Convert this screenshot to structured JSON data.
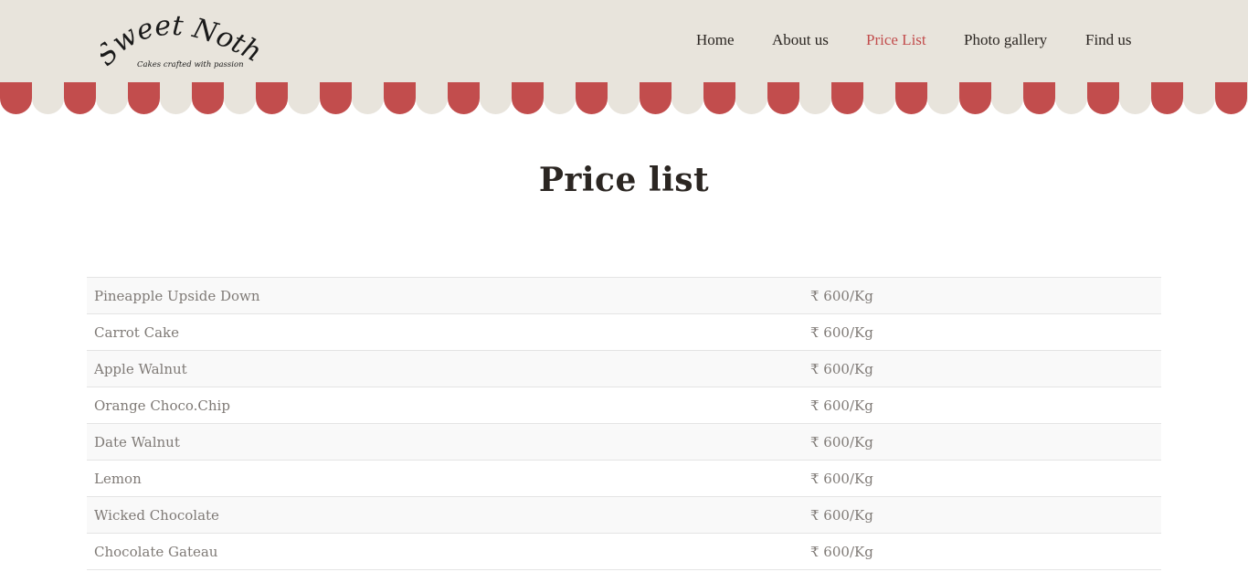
{
  "logo": {
    "title": "Sweet Nothings",
    "tagline": "Cakes crafted with passion"
  },
  "nav": {
    "items": [
      {
        "label": "Home",
        "active": false
      },
      {
        "label": "About us",
        "active": false
      },
      {
        "label": "Price List",
        "active": true
      },
      {
        "label": "Photo gallery",
        "active": false
      },
      {
        "label": "Find us",
        "active": false
      }
    ]
  },
  "colors": {
    "header_bg": "#e8e4dc",
    "accent": "#c24d4d",
    "text": "#2b2622",
    "table_text": "#7f7a76"
  },
  "main": {
    "title": "Price list",
    "prices": [
      {
        "name": "Pineapple Upside Down",
        "price": "₹ 600/Kg"
      },
      {
        "name": "Carrot Cake",
        "price": "₹ 600/Kg"
      },
      {
        "name": "Apple Walnut",
        "price": "₹ 600/Kg"
      },
      {
        "name": "Orange Choco.Chip",
        "price": "₹ 600/Kg"
      },
      {
        "name": "Date Walnut",
        "price": "₹ 600/Kg"
      },
      {
        "name": "Lemon",
        "price": "₹ 600/Kg"
      },
      {
        "name": "Wicked Chocolate",
        "price": "₹ 600/Kg"
      },
      {
        "name": "Chocolate Gateau",
        "price": "₹ 600/Kg"
      }
    ]
  }
}
